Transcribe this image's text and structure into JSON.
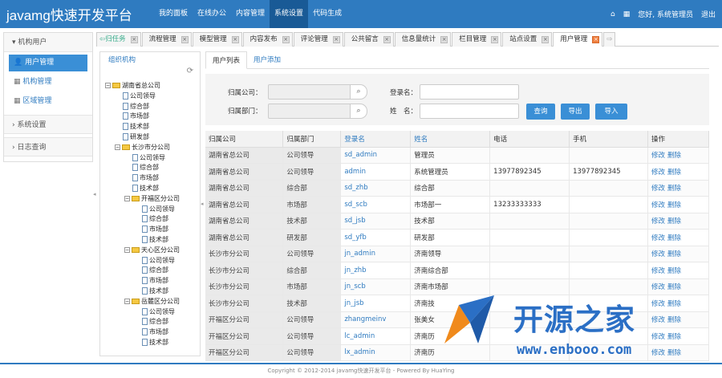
{
  "app": {
    "title": "javamg快速开发平台"
  },
  "nav": [
    "我的面板",
    "在线办公",
    "内容管理",
    "系统设置",
    "代码生成"
  ],
  "top_right": {
    "greeting": "您好, 系统管理员",
    "logout": "退出"
  },
  "sidebar": {
    "group1": "机构用户",
    "items": [
      "用户管理",
      "机构管理",
      "区域管理"
    ],
    "group2": "系统设置",
    "group3": "日志查询"
  },
  "tabs": [
    "归任务",
    "流程管理",
    "模型管理",
    "内容发布",
    "评论管理",
    "公共留言",
    "信息量统计",
    "栏目管理",
    "站点设置",
    "用户管理"
  ],
  "org": {
    "title": "组织机构",
    "tree": [
      {
        "t": "湖南省总公司",
        "lvl": 0,
        "k": "folder"
      },
      {
        "t": "公司领导",
        "lvl": 1,
        "k": "page"
      },
      {
        "t": "综合部",
        "lvl": 1,
        "k": "page"
      },
      {
        "t": "市场部",
        "lvl": 1,
        "k": "page"
      },
      {
        "t": "技术部",
        "lvl": 1,
        "k": "page"
      },
      {
        "t": "研发部",
        "lvl": 1,
        "k": "page"
      },
      {
        "t": "长沙市分公司",
        "lvl": 1,
        "k": "folder"
      },
      {
        "t": "公司领导",
        "lvl": 2,
        "k": "page"
      },
      {
        "t": "综合部",
        "lvl": 2,
        "k": "page"
      },
      {
        "t": "市场部",
        "lvl": 2,
        "k": "page"
      },
      {
        "t": "技术部",
        "lvl": 2,
        "k": "page"
      },
      {
        "t": "开福区分公司",
        "lvl": 2,
        "k": "folder"
      },
      {
        "t": "公司领导",
        "lvl": 3,
        "k": "page"
      },
      {
        "t": "综合部",
        "lvl": 3,
        "k": "page"
      },
      {
        "t": "市场部",
        "lvl": 3,
        "k": "page"
      },
      {
        "t": "技术部",
        "lvl": 3,
        "k": "page"
      },
      {
        "t": "天心区分公司",
        "lvl": 2,
        "k": "folder"
      },
      {
        "t": "公司领导",
        "lvl": 3,
        "k": "page"
      },
      {
        "t": "综合部",
        "lvl": 3,
        "k": "page"
      },
      {
        "t": "市场部",
        "lvl": 3,
        "k": "page"
      },
      {
        "t": "技术部",
        "lvl": 3,
        "k": "page"
      },
      {
        "t": "岳麓区分公司",
        "lvl": 2,
        "k": "folder"
      },
      {
        "t": "公司领导",
        "lvl": 3,
        "k": "page"
      },
      {
        "t": "综合部",
        "lvl": 3,
        "k": "page"
      },
      {
        "t": "市场部",
        "lvl": 3,
        "k": "page"
      },
      {
        "t": "技术部",
        "lvl": 3,
        "k": "page"
      }
    ]
  },
  "subtabs": [
    "用户列表",
    "用户添加"
  ],
  "form": {
    "company_label": "归属公司：",
    "dept_label": "归属部门：",
    "login_label": "登录名：",
    "name_label": "姓　名：",
    "query": "查询",
    "export": "导出",
    "import": "导入"
  },
  "table": {
    "headers": [
      "归属公司",
      "归属部门",
      "登录名",
      "姓名",
      "电话",
      "手机",
      "操作"
    ],
    "rows": [
      [
        "湖南省总公司",
        "公司领导",
        "sd_admin",
        "管理员",
        "",
        ""
      ],
      [
        "湖南省总公司",
        "公司领导",
        "admin",
        "系统管理员",
        "13977892345",
        "13977892345"
      ],
      [
        "湖南省总公司",
        "综合部",
        "sd_zhb",
        "综合部",
        "",
        ""
      ],
      [
        "湖南省总公司",
        "市场部",
        "sd_scb",
        "市场部一",
        "13233333333",
        ""
      ],
      [
        "湖南省总公司",
        "技术部",
        "sd_jsb",
        "技术部",
        "",
        ""
      ],
      [
        "湖南省总公司",
        "研发部",
        "sd_yfb",
        "研发部",
        "",
        ""
      ],
      [
        "长沙市分公司",
        "公司领导",
        "jn_admin",
        "济南领导",
        "",
        ""
      ],
      [
        "长沙市分公司",
        "综合部",
        "jn_zhb",
        "济南综合部",
        "",
        ""
      ],
      [
        "长沙市分公司",
        "市场部",
        "jn_scb",
        "济南市场部",
        "",
        ""
      ],
      [
        "长沙市分公司",
        "技术部",
        "jn_jsb",
        "济南技",
        "",
        ""
      ],
      [
        "开福区分公司",
        "公司领导",
        "zhangmeinv",
        "张美女",
        "",
        ""
      ],
      [
        "开福区分公司",
        "公司领导",
        "lc_admin",
        "济南历",
        "",
        ""
      ],
      [
        "开福区分公司",
        "公司领导",
        "lx_admin",
        "济南历",
        "",
        ""
      ]
    ],
    "op_edit": "修改",
    "op_delete": "删除"
  },
  "footer": "Copyright © 2012-2014 javamg快速开发平台 - Powered By HuaYing",
  "watermark": {
    "name": "开源之家",
    "url": "www.enbooo.com"
  },
  "colors": {
    "topbar": "#2f7bc0",
    "nav_active": "#195a96",
    "accent": "#3a8fd6",
    "watermark": "#2b6fc5",
    "close_active": "#f08040"
  }
}
